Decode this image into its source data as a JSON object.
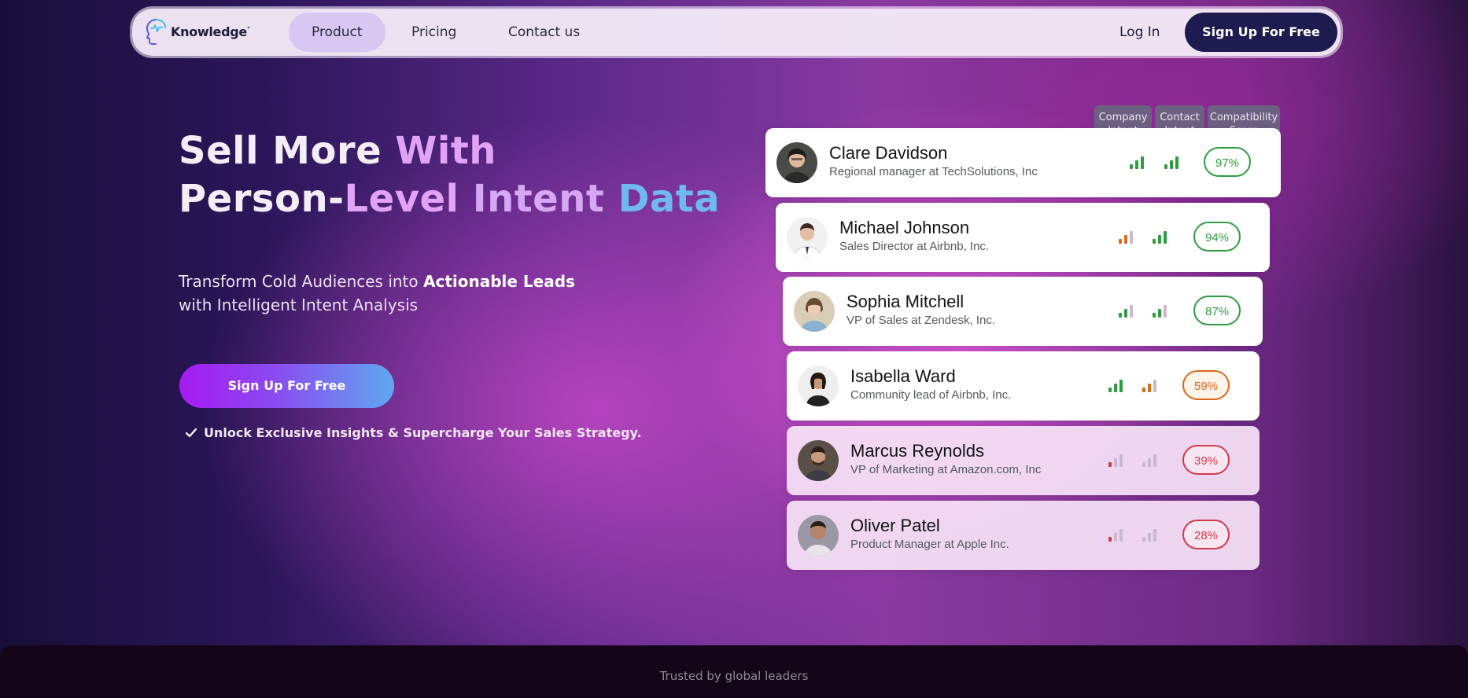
{
  "nav": {
    "logo_text": "Knowledge",
    "logo_sup": "°",
    "links": [
      "Product",
      "Pricing",
      "Contact us"
    ],
    "login": "Log In",
    "signup": "Sign Up For Free"
  },
  "hero": {
    "title_line1_a": "Sell More ",
    "title_line1_b": "With",
    "title_line2_a": "Person-",
    "title_line2_b": "Level ",
    "title_line2_c": "Intent ",
    "title_line2_d": "Data",
    "subtitle_a": "Transform Cold Audiences into ",
    "subtitle_bold": "Actionable Leads",
    "subtitle_b": "with Intelligent Intent Analysis",
    "cta": "Sign Up For Free",
    "check_text": "Unlock Exclusive Insights & Supercharge Your Sales Strategy."
  },
  "columns": {
    "company_l1": "Company",
    "company_l2": "Intent",
    "contact_l1": "Contact",
    "contact_l2": "Intent",
    "score_l1": "Compatibility",
    "score_l2": "Score"
  },
  "colors": {
    "green": "#2e9d3e",
    "orange": "#d86a1a",
    "red": "#d03a4a",
    "gray": "#c9b8cf"
  },
  "leads": [
    {
      "name": "Clare Davidson",
      "role": "Regional manager at TechSolutions, Inc",
      "company_level": 3,
      "company_color": "green",
      "contact_level": 3,
      "contact_color": "green",
      "score": "97%",
      "score_color": "green"
    },
    {
      "name": "Michael Johnson",
      "role": "Sales Director at Airbnb, Inc.",
      "company_level": 2,
      "company_color": "orange",
      "contact_level": 3,
      "contact_color": "green",
      "score": "94%",
      "score_color": "green"
    },
    {
      "name": "Sophia Mitchell",
      "role": "VP of Sales at Zendesk, Inc.",
      "company_level": 2,
      "company_color": "green",
      "contact_level": 2,
      "contact_color": "green",
      "score": "87%",
      "score_color": "green"
    },
    {
      "name": "Isabella Ward",
      "role": "Community lead of Airbnb, Inc.",
      "company_level": 3,
      "company_color": "green",
      "contact_level": 2,
      "contact_color": "orange",
      "score": "59%",
      "score_color": "orange"
    },
    {
      "name": "Marcus Reynolds",
      "role": "VP of Marketing at Amazon.com, Inc",
      "company_level": 1,
      "company_color": "red",
      "contact_level": 0,
      "contact_color": "gray",
      "score": "39%",
      "score_color": "red"
    },
    {
      "name": "Oliver Patel",
      "role": "Product Manager at Apple Inc.",
      "company_level": 1,
      "company_color": "red",
      "contact_level": 0,
      "contact_color": "gray",
      "score": "28%",
      "score_color": "red"
    }
  ],
  "footer": {
    "text": "Trusted by global leaders"
  }
}
